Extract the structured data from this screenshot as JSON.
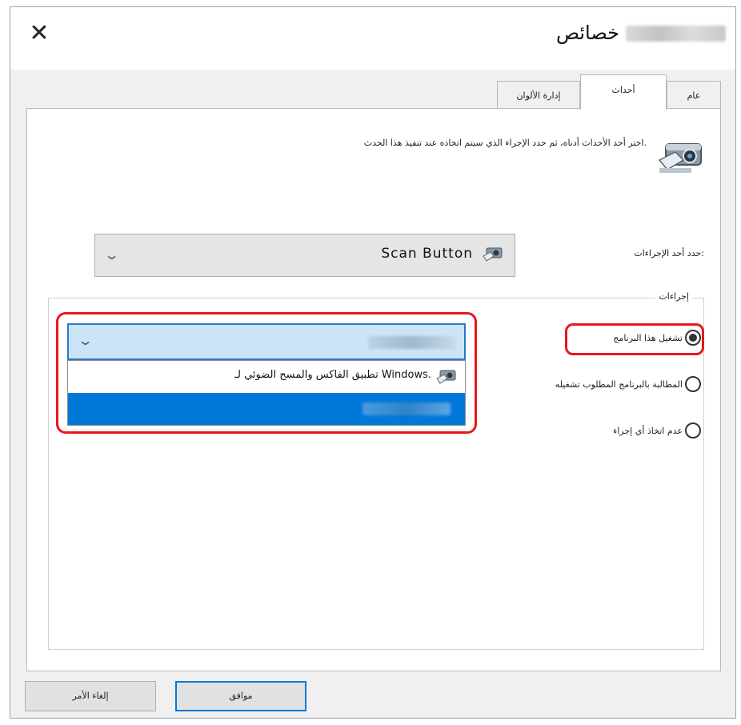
{
  "window": {
    "title": "خصائص",
    "close_glyph": "✕"
  },
  "tabs": [
    {
      "label": "عام",
      "active": false
    },
    {
      "label": "أحداث",
      "active": true
    },
    {
      "label": "إدارة الألوان",
      "active": false
    }
  ],
  "events_tab": {
    "description": "اختر أحد الأحداث أدناه، ثم حدد الإجراء الذي سيتم اتخاذه عند تنفيذ هذا الحدث.",
    "select_event_label": "حدد أحد الإجراءات:",
    "selected_event": "Scan Button",
    "actions_group_title": "إجراءات",
    "radio_options": [
      {
        "label": "تشغيل هذا البرنامج",
        "checked": true
      },
      {
        "label": "المطالبة بالبرنامج المطلوب تشغيله",
        "checked": false
      },
      {
        "label": "عدم اتخاذ أي إجراء",
        "checked": false
      }
    ],
    "program_dropdown": {
      "items": [
        {
          "label": "تطبيق الفاكس والمسح الضوئي لـ Windows.",
          "highlighted": false
        }
      ]
    }
  },
  "buttons": {
    "ok": "موافق",
    "cancel": "إلغاء الأمر"
  },
  "colors": {
    "highlight": "#0078d7",
    "annotation_red": "#e8171d"
  },
  "icons": [
    "close-icon",
    "scanner-camera-icon",
    "scanner-small-icon",
    "chevron-down-icon",
    "radio-icon"
  ]
}
